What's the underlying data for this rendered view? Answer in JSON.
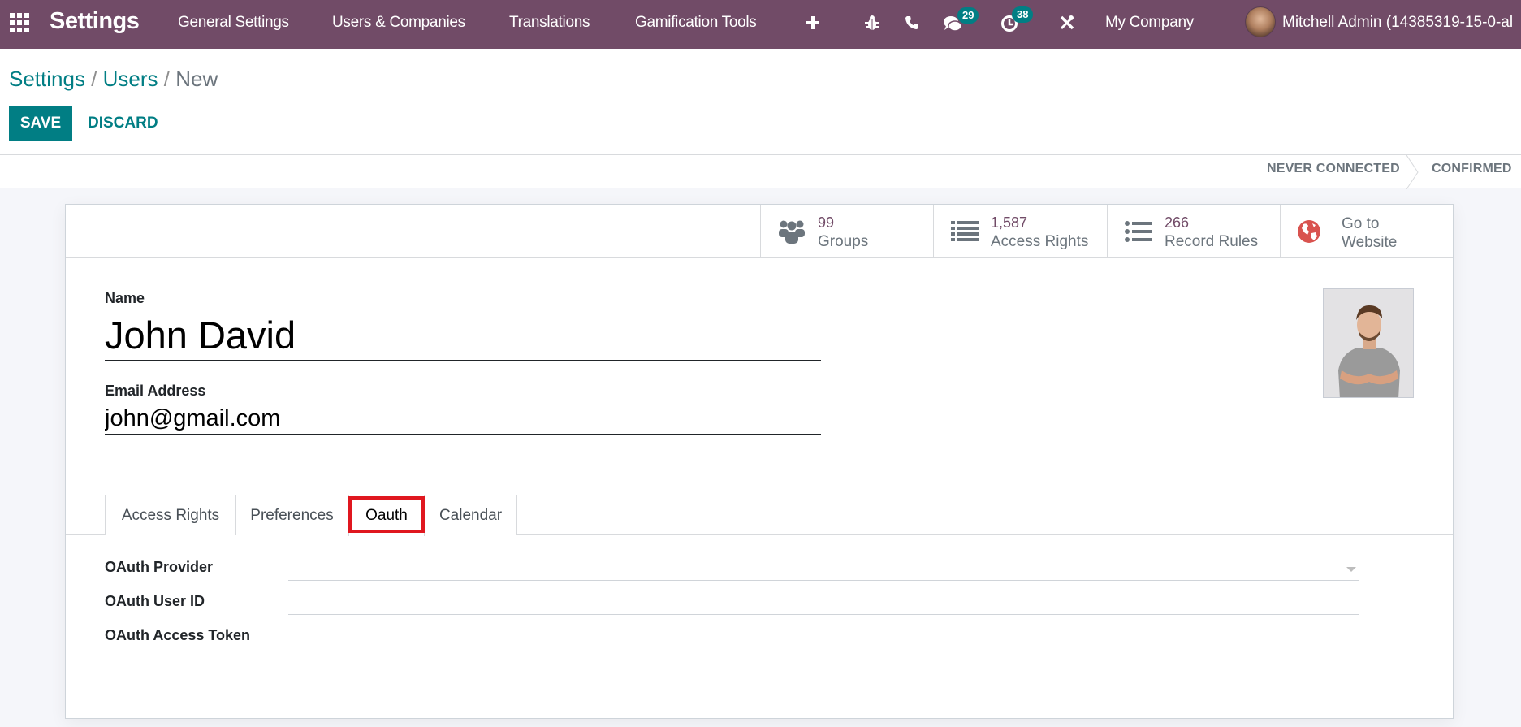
{
  "navbar": {
    "app_title": "Settings",
    "menu": [
      {
        "label": "General Settings"
      },
      {
        "label": "Users & Companies"
      },
      {
        "label": "Translations"
      },
      {
        "label": "Gamification Tools"
      }
    ],
    "icons": {
      "apps": "apps-grid-icon",
      "add": "plus-icon",
      "debug": "bug-icon",
      "phone": "phone-icon",
      "messages": "chat-icon",
      "activities": "clock-icon",
      "tools": "tools-icon"
    },
    "messages_count": "29",
    "activities_count": "38",
    "company": "My Company",
    "user": "Mitchell Admin (14385319-15-0-al"
  },
  "breadcrumb": {
    "items": [
      {
        "label": "Settings"
      },
      {
        "label": "Users"
      }
    ],
    "separator": "/",
    "current": "New"
  },
  "actions": {
    "save": "SAVE",
    "discard": "DISCARD"
  },
  "statusbar": {
    "stages": [
      {
        "label": "NEVER CONNECTED"
      },
      {
        "label": "CONFIRMED"
      }
    ]
  },
  "smart_buttons": [
    {
      "value": "99",
      "label": "Groups",
      "icon": "users-icon"
    },
    {
      "value": "1,587",
      "label": "Access Rights",
      "icon": "list-icon"
    },
    {
      "value": "266",
      "label": "Record Rules",
      "icon": "list-ul-icon"
    },
    {
      "line1": "Go to",
      "line2": "Website",
      "icon": "globe-icon"
    }
  ],
  "form": {
    "name_label": "Name",
    "name_value": "John David",
    "email_label": "Email Address",
    "email_value": "john@gmail.com"
  },
  "tabs": [
    {
      "label": "Access Rights"
    },
    {
      "label": "Preferences"
    },
    {
      "label": "Oauth",
      "active": true
    },
    {
      "label": "Calendar"
    }
  ],
  "oauth": {
    "provider_label": "OAuth Provider",
    "provider_value": "",
    "user_id_label": "OAuth User ID",
    "user_id_value": "",
    "token_label": "OAuth Access Token",
    "token_value": ""
  },
  "colors": {
    "navbar": "#714b67",
    "primary": "#017e84",
    "highlight": "#e0171f",
    "stat_value": "#714b67"
  }
}
